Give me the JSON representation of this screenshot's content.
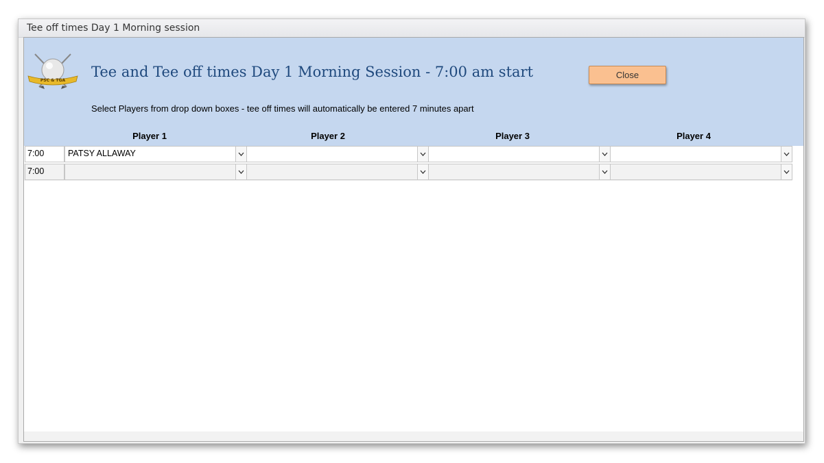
{
  "window": {
    "title": "Tee off times Day 1 Morning session"
  },
  "header": {
    "title": "Tee and Tee off times Day 1 Morning Session - 7:00 am start",
    "close_label": "Close",
    "instructions": "Select Players from drop down boxes - tee off times will automatically be entered 7 minutes apart",
    "logo_text": "PSC & TGA"
  },
  "columns": [
    "Player 1",
    "Player 2",
    "Player 3",
    "Player 4"
  ],
  "rows": [
    {
      "time": "7:00",
      "players": [
        "PATSY ALLAWAY",
        "",
        "",
        ""
      ]
    },
    {
      "time": "7:00",
      "players": [
        "",
        "",
        "",
        ""
      ]
    }
  ],
  "colors": {
    "header_bg": "#c5d7ef",
    "title_color": "#1f497d",
    "close_button_bg": "#fac090"
  }
}
